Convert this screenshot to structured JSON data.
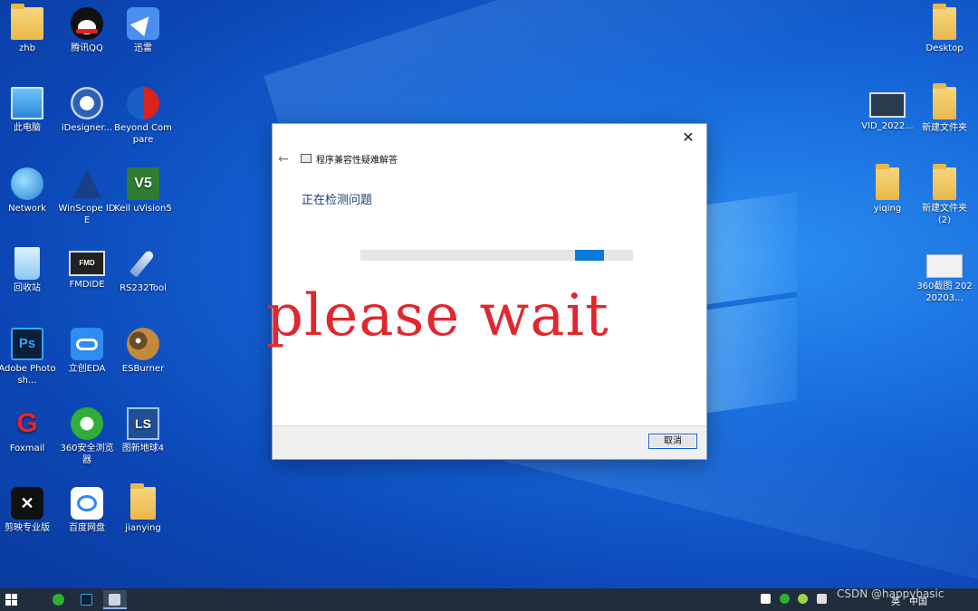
{
  "desktop": {
    "left_icons": [
      {
        "label": "zhb",
        "icon": "user-folder-icon"
      },
      {
        "label": "腾讯QQ",
        "icon": "qq-penguin-icon"
      },
      {
        "label": "迅雷",
        "icon": "thunder-bird-icon"
      },
      {
        "label": "此电脑",
        "icon": "computer-icon"
      },
      {
        "label": "iDesigner...",
        "icon": "idesigner-icon"
      },
      {
        "label": "Beyond Compare",
        "icon": "beyond-compare-icon"
      },
      {
        "label": "Network",
        "icon": "network-globe-icon"
      },
      {
        "label": "WinScope IDE",
        "icon": "winscope-icon"
      },
      {
        "label": "Keil uVision5",
        "icon": "keil-icon"
      },
      {
        "label": "回收站",
        "icon": "recycle-bin-icon"
      },
      {
        "label": "FMDIDE",
        "icon": "fmdide-chip-icon"
      },
      {
        "label": "RS232Tool",
        "icon": "rocket-icon"
      },
      {
        "label": "Adobe Photosh...",
        "icon": "photoshop-icon"
      },
      {
        "label": "立创EDA",
        "icon": "lceda-cloud-icon"
      },
      {
        "label": "ESBurner",
        "icon": "owl-shield-icon"
      },
      {
        "label": "Foxmail",
        "icon": "foxmail-icon"
      },
      {
        "label": "360安全浏览器",
        "icon": "360-browser-icon"
      },
      {
        "label": "图新地球4",
        "icon": "tuxin-earth-icon"
      },
      {
        "label": "剪映专业版",
        "icon": "jianying-icon"
      },
      {
        "label": "百度网盘",
        "icon": "baidu-netdisk-icon"
      },
      {
        "label": "jianying",
        "icon": "folder-icon"
      }
    ],
    "right_icons": [
      {
        "label": "Desktop",
        "icon": "folder-icon"
      },
      {
        "label": "VID_2022...",
        "icon": "video-file-icon"
      },
      {
        "label": "新建文件夹",
        "icon": "folder-icon"
      },
      {
        "label": "yiqing",
        "icon": "folder-icon"
      },
      {
        "label": "新建文件夹 (2)",
        "icon": "folder-icon"
      },
      {
        "label": "360截图 20220203...",
        "icon": "image-file-icon"
      }
    ]
  },
  "dialog": {
    "window_title": "程序兼容性疑难解答",
    "heading": "正在检测问题",
    "progress": "indeterminate",
    "cancel_label": "取消",
    "close_glyph": "✕",
    "back_glyph": "←",
    "accent_color": "#0a7ad8"
  },
  "overlay": {
    "text": "please wait",
    "color": "#e0272e"
  },
  "taskbar": {
    "start_icon": "windows-start-icon",
    "pinned": [
      "360-browser-icon",
      "photoshop-icon",
      "troubleshooter-icon"
    ],
    "tray": {
      "language": "英",
      "partial_text": "中国"
    }
  },
  "watermark": {
    "text": "CSDN @happybasic"
  }
}
